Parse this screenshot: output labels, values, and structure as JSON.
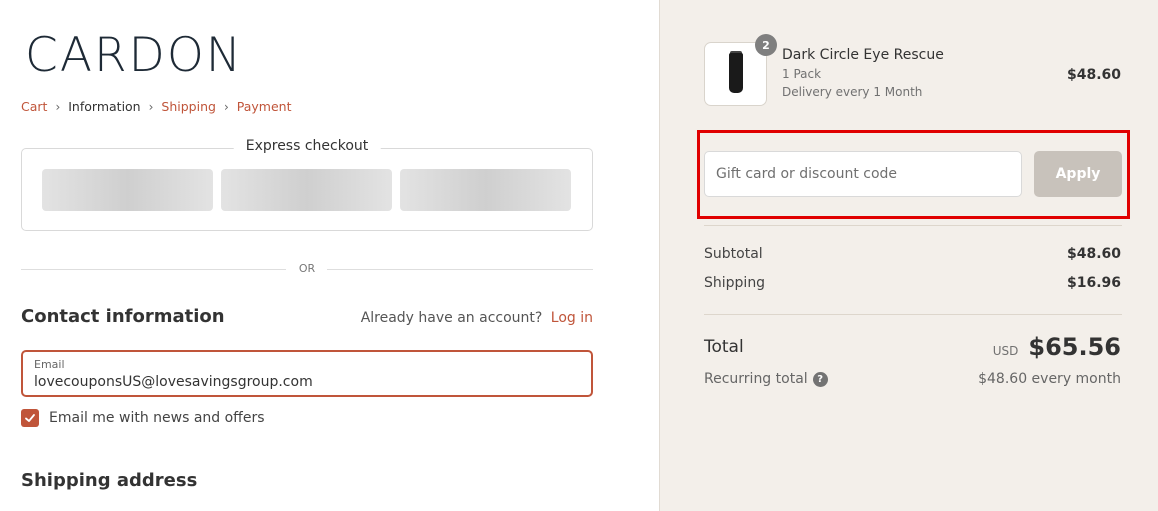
{
  "brand": {
    "logo_text": "CARDON",
    "link_color": "#c0553a"
  },
  "breadcrumb": {
    "items": [
      {
        "label": "Cart",
        "current": false
      },
      {
        "label": "Information",
        "current": true
      },
      {
        "label": "Shipping",
        "current": false
      },
      {
        "label": "Payment",
        "current": false
      }
    ],
    "separator_icon": "chevron-right-icon"
  },
  "express_checkout": {
    "title": "Express checkout",
    "buttons": [
      "payment-option-1",
      "payment-option-2",
      "payment-option-3"
    ]
  },
  "divider_text": "OR",
  "contact": {
    "title": "Contact information",
    "account_prompt": "Already have an account?",
    "login_label": "Log in",
    "email_label": "Email",
    "email_value": "lovecouponsUS@lovesavingsgroup.com",
    "newsletter_label": "Email me with news and offers",
    "newsletter_checked": true
  },
  "shipping": {
    "title": "Shipping address"
  },
  "order_summary": {
    "product": {
      "name": "Dark Circle Eye Rescue",
      "variant": "1 Pack",
      "delivery": "Delivery every 1 Month",
      "price": "$48.60",
      "quantity": "2"
    },
    "discount": {
      "placeholder": "Gift card or discount code",
      "apply_label": "Apply"
    },
    "subtotal_label": "Subtotal",
    "subtotal_value": "$48.60",
    "shipping_label": "Shipping",
    "shipping_value": "$16.96",
    "total_label": "Total",
    "currency": "USD",
    "total_value": "$65.56",
    "recurring_label": "Recurring total",
    "help_icon": "?",
    "recurring_value": "$48.60 every month"
  },
  "highlight_color": "#e00000"
}
